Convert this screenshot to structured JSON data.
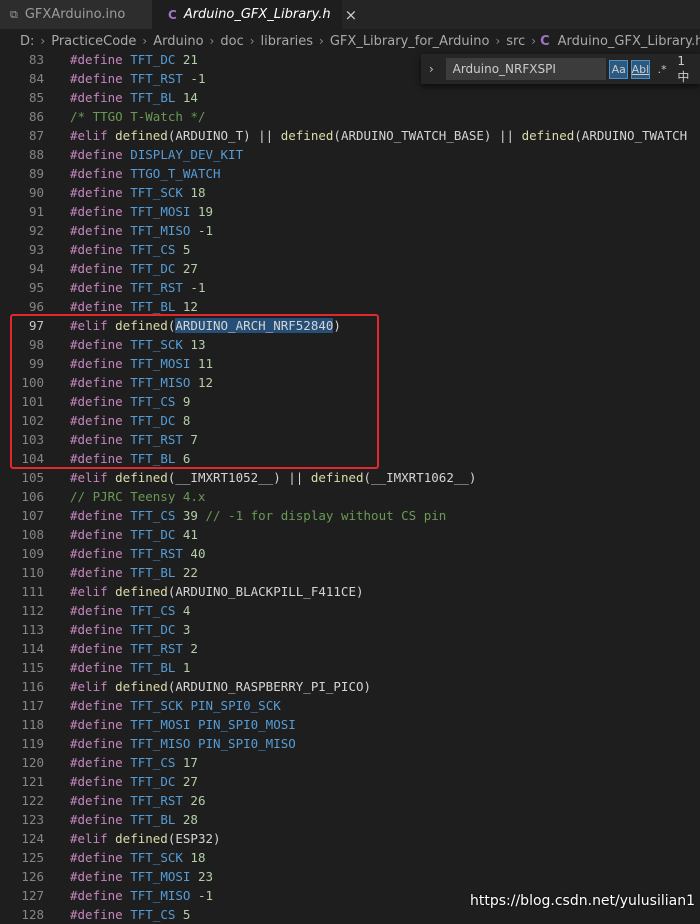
{
  "tabs": [
    {
      "label": "GFXArduino.ino",
      "icon": "ino-file-icon",
      "glyph": "⧉"
    },
    {
      "label": "Arduino_GFX_Library.h",
      "icon": "c-file-icon",
      "glyph": "C",
      "close": "×"
    }
  ],
  "breadcrumbs": [
    "D:",
    "PracticeCode",
    "Arduino",
    "doc",
    "libraries",
    "GFX_Library_for_Arduino",
    "src",
    "Arduino_GFX_Library.h",
    "..."
  ],
  "find": {
    "chevron": "›",
    "value": "Arduino_NRFXSPI",
    "match_case": "Aa",
    "whole_word": "Abl",
    "regex": ".*",
    "count": "1 中"
  },
  "colors": {
    "keyword": "#c586c0",
    "identifier": "#569cd6",
    "number": "#b5cea8",
    "comment": "#6a9955",
    "highlight": "#264f78",
    "box": "#e0282d"
  },
  "lines": [
    {
      "n": "83",
      "t": [
        [
          "#define ",
          "k"
        ],
        [
          "TFT_DC",
          "n"
        ],
        [
          " 21",
          "nu"
        ]
      ]
    },
    {
      "n": "84",
      "t": [
        [
          "#define ",
          "k"
        ],
        [
          "TFT_RST",
          "n"
        ],
        [
          " -1",
          "nu"
        ]
      ]
    },
    {
      "n": "85",
      "t": [
        [
          "#define ",
          "k"
        ],
        [
          "TFT_BL",
          "n"
        ],
        [
          " 14",
          "nu"
        ]
      ]
    },
    {
      "n": "86",
      "t": [
        [
          "/* TTGO T-Watch */",
          "cm"
        ]
      ]
    },
    {
      "n": "87",
      "t": [
        [
          "#elif ",
          "k"
        ],
        [
          "defined",
          "f"
        ],
        [
          "(ARDUINO_T) || ",
          "p"
        ],
        [
          "defined",
          "f"
        ],
        [
          "(ARDUINO_TWATCH_BASE) || ",
          "p"
        ],
        [
          "defined",
          "f"
        ],
        [
          "(ARDUINO_TWATCH",
          "p"
        ]
      ]
    },
    {
      "n": "88",
      "t": [
        [
          "#define ",
          "k"
        ],
        [
          "DISPLAY_DEV_KIT",
          "n"
        ]
      ]
    },
    {
      "n": "89",
      "t": [
        [
          "#define ",
          "k"
        ],
        [
          "TTGO_T_WATCH",
          "n"
        ]
      ]
    },
    {
      "n": "90",
      "t": [
        [
          "#define ",
          "k"
        ],
        [
          "TFT_SCK",
          "n"
        ],
        [
          " 18",
          "nu"
        ]
      ]
    },
    {
      "n": "91",
      "t": [
        [
          "#define ",
          "k"
        ],
        [
          "TFT_MOSI",
          "n"
        ],
        [
          " 19",
          "nu"
        ]
      ]
    },
    {
      "n": "92",
      "t": [
        [
          "#define ",
          "k"
        ],
        [
          "TFT_MISO",
          "n"
        ],
        [
          " -1",
          "nu"
        ]
      ]
    },
    {
      "n": "93",
      "t": [
        [
          "#define ",
          "k"
        ],
        [
          "TFT_CS",
          "n"
        ],
        [
          " 5",
          "nu"
        ]
      ]
    },
    {
      "n": "94",
      "t": [
        [
          "#define ",
          "k"
        ],
        [
          "TFT_DC",
          "n"
        ],
        [
          " 27",
          "nu"
        ]
      ]
    },
    {
      "n": "95",
      "t": [
        [
          "#define ",
          "k"
        ],
        [
          "TFT_RST",
          "n"
        ],
        [
          " -1",
          "nu"
        ]
      ]
    },
    {
      "n": "96",
      "t": [
        [
          "#define ",
          "k"
        ],
        [
          "TFT_BL",
          "n"
        ],
        [
          " 12",
          "nu"
        ]
      ]
    },
    {
      "n": "97",
      "cur": true,
      "t": [
        [
          "#elif ",
          "k"
        ],
        [
          "defined",
          "f"
        ],
        [
          "(",
          "p"
        ],
        [
          "ARDUINO_ARCH_NRF52840",
          "hl"
        ],
        [
          ")",
          "p"
        ]
      ]
    },
    {
      "n": "98",
      "t": [
        [
          "#define ",
          "k"
        ],
        [
          "TFT_SCK",
          "n"
        ],
        [
          " 13",
          "nu"
        ]
      ]
    },
    {
      "n": "99",
      "t": [
        [
          "#define ",
          "k"
        ],
        [
          "TFT_MOSI",
          "n"
        ],
        [
          " 11",
          "nu"
        ]
      ]
    },
    {
      "n": "100",
      "t": [
        [
          "#define ",
          "k"
        ],
        [
          "TFT_MISO",
          "n"
        ],
        [
          " 12",
          "nu"
        ]
      ]
    },
    {
      "n": "101",
      "t": [
        [
          "#define ",
          "k"
        ],
        [
          "TFT_CS",
          "n"
        ],
        [
          " 9",
          "nu"
        ]
      ]
    },
    {
      "n": "102",
      "t": [
        [
          "#define ",
          "k"
        ],
        [
          "TFT_DC",
          "n"
        ],
        [
          " 8",
          "nu"
        ]
      ]
    },
    {
      "n": "103",
      "t": [
        [
          "#define ",
          "k"
        ],
        [
          "TFT_RST",
          "n"
        ],
        [
          " 7",
          "nu"
        ]
      ]
    },
    {
      "n": "104",
      "t": [
        [
          "#define ",
          "k"
        ],
        [
          "TFT_BL",
          "n"
        ],
        [
          " 6",
          "nu"
        ]
      ]
    },
    {
      "n": "105",
      "t": [
        [
          "#elif ",
          "k"
        ],
        [
          "defined",
          "f"
        ],
        [
          "(__IMXRT1052__) || ",
          "p"
        ],
        [
          "defined",
          "f"
        ],
        [
          "(__IMXRT1062__)",
          "p"
        ]
      ]
    },
    {
      "n": "106",
      "t": [
        [
          "// PJRC Teensy 4.x",
          "cm"
        ]
      ]
    },
    {
      "n": "107",
      "t": [
        [
          "#define ",
          "k"
        ],
        [
          "TFT_CS",
          "n"
        ],
        [
          " 39",
          "nu"
        ],
        [
          " // -1 for display without CS pin",
          "cm"
        ]
      ]
    },
    {
      "n": "108",
      "t": [
        [
          "#define ",
          "k"
        ],
        [
          "TFT_DC",
          "n"
        ],
        [
          " 41",
          "nu"
        ]
      ]
    },
    {
      "n": "109",
      "t": [
        [
          "#define ",
          "k"
        ],
        [
          "TFT_RST",
          "n"
        ],
        [
          " 40",
          "nu"
        ]
      ]
    },
    {
      "n": "110",
      "t": [
        [
          "#define ",
          "k"
        ],
        [
          "TFT_BL",
          "n"
        ],
        [
          " 22",
          "nu"
        ]
      ]
    },
    {
      "n": "111",
      "t": [
        [
          "#elif ",
          "k"
        ],
        [
          "defined",
          "f"
        ],
        [
          "(ARDUINO_BLACKPILL_F411CE)",
          "p"
        ]
      ]
    },
    {
      "n": "112",
      "t": [
        [
          "#define ",
          "k"
        ],
        [
          "TFT_CS",
          "n"
        ],
        [
          " 4",
          "nu"
        ]
      ]
    },
    {
      "n": "113",
      "t": [
        [
          "#define ",
          "k"
        ],
        [
          "TFT_DC",
          "n"
        ],
        [
          " 3",
          "nu"
        ]
      ]
    },
    {
      "n": "114",
      "t": [
        [
          "#define ",
          "k"
        ],
        [
          "TFT_RST",
          "n"
        ],
        [
          " 2",
          "nu"
        ]
      ]
    },
    {
      "n": "115",
      "t": [
        [
          "#define ",
          "k"
        ],
        [
          "TFT_BL",
          "n"
        ],
        [
          " 1",
          "nu"
        ]
      ]
    },
    {
      "n": "116",
      "t": [
        [
          "#elif ",
          "k"
        ],
        [
          "defined",
          "f"
        ],
        [
          "(ARDUINO_RASPBERRY_PI_PICO)",
          "p"
        ]
      ]
    },
    {
      "n": "117",
      "t": [
        [
          "#define ",
          "k"
        ],
        [
          "TFT_SCK ",
          "n"
        ],
        [
          "PIN_SPI0_SCK",
          "n"
        ]
      ]
    },
    {
      "n": "118",
      "t": [
        [
          "#define ",
          "k"
        ],
        [
          "TFT_MOSI ",
          "n"
        ],
        [
          "PIN_SPI0_MOSI",
          "n"
        ]
      ]
    },
    {
      "n": "119",
      "t": [
        [
          "#define ",
          "k"
        ],
        [
          "TFT_MISO ",
          "n"
        ],
        [
          "PIN_SPI0_MISO",
          "n"
        ]
      ]
    },
    {
      "n": "120",
      "t": [
        [
          "#define ",
          "k"
        ],
        [
          "TFT_CS",
          "n"
        ],
        [
          " 17",
          "nu"
        ]
      ]
    },
    {
      "n": "121",
      "t": [
        [
          "#define ",
          "k"
        ],
        [
          "TFT_DC",
          "n"
        ],
        [
          " 27",
          "nu"
        ]
      ]
    },
    {
      "n": "122",
      "t": [
        [
          "#define ",
          "k"
        ],
        [
          "TFT_RST",
          "n"
        ],
        [
          " 26",
          "nu"
        ]
      ]
    },
    {
      "n": "123",
      "t": [
        [
          "#define ",
          "k"
        ],
        [
          "TFT_BL",
          "n"
        ],
        [
          " 28",
          "nu"
        ]
      ]
    },
    {
      "n": "124",
      "t": [
        [
          "#elif ",
          "k"
        ],
        [
          "defined",
          "f"
        ],
        [
          "(ESP32)",
          "p"
        ]
      ]
    },
    {
      "n": "125",
      "t": [
        [
          "#define ",
          "k"
        ],
        [
          "TFT_SCK",
          "n"
        ],
        [
          " 18",
          "nu"
        ]
      ]
    },
    {
      "n": "126",
      "t": [
        [
          "#define ",
          "k"
        ],
        [
          "TFT_MOSI",
          "n"
        ],
        [
          " 23",
          "nu"
        ]
      ]
    },
    {
      "n": "127",
      "t": [
        [
          "#define ",
          "k"
        ],
        [
          "TFT_MISO",
          "n"
        ],
        [
          " -1",
          "nu"
        ]
      ]
    },
    {
      "n": "128",
      "t": [
        [
          "#define ",
          "k"
        ],
        [
          "TFT_CS",
          "n"
        ],
        [
          " 5",
          "nu"
        ]
      ]
    }
  ],
  "watermark": "https://blog.csdn.net/yulusilian1"
}
